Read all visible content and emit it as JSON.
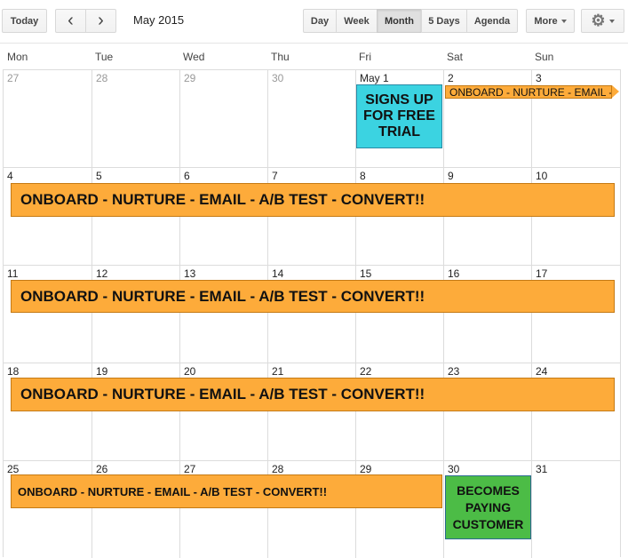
{
  "toolbar": {
    "today": "Today",
    "prev_icon": "‹",
    "next_icon": "›",
    "title": "May 2015",
    "views": [
      "Day",
      "Week",
      "Month",
      "5 Days",
      "Agenda"
    ],
    "active_view": "Month",
    "more": "More",
    "settings_icon": "⚙"
  },
  "weekdays": [
    "Mon",
    "Tue",
    "Wed",
    "Thu",
    "Fri",
    "Sat",
    "Sun"
  ],
  "weeks": [
    [
      "27",
      "28",
      "29",
      "30",
      "May 1",
      "2",
      "3"
    ],
    [
      "4",
      "5",
      "6",
      "7",
      "8",
      "9",
      "10"
    ],
    [
      "11",
      "12",
      "13",
      "14",
      "15",
      "16",
      "17"
    ],
    [
      "18",
      "19",
      "20",
      "21",
      "22",
      "23",
      "24"
    ],
    [
      "25",
      "26",
      "27",
      "28",
      "29",
      "30",
      "31"
    ]
  ],
  "events": {
    "signup": "SIGNS UP FOR FREE TRIAL",
    "onboard_short": "ONBOARD - NURTURE - EMAIL -",
    "onboard": "ONBOARD - NURTURE - EMAIL - A/B TEST - CONVERT!!",
    "paying": "BECOMES PAYING CUSTOMER"
  },
  "colors": {
    "onboard": "#fdab3a",
    "signup": "#3bd3e1",
    "paying": "#4cbc46"
  }
}
